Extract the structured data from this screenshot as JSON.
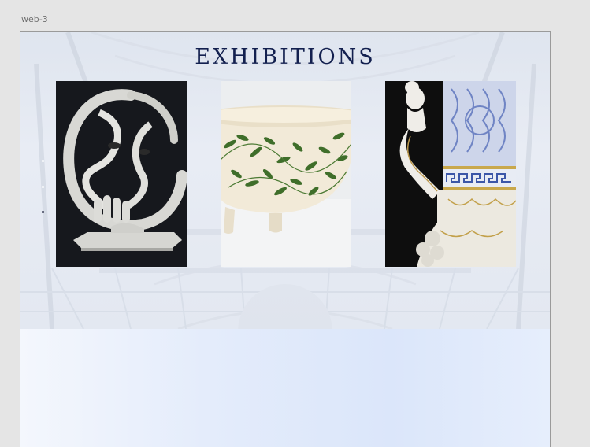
{
  "frame": {
    "label": "web-3"
  },
  "hero": {
    "title": "EXHIBITIONS"
  },
  "exhibits": [
    {
      "name": "ceramic-face-sculpture",
      "subject": "abstract white ceramic sculpture of faces in a ring on a dark background"
    },
    {
      "name": "leaf-pattern-bowl",
      "subject": "footed cream bowl painted with green leaf pattern"
    },
    {
      "name": "porcelain-vase-figure",
      "subject": "white and gold porcelain vase with blue pattern and figure handle"
    }
  ],
  "colors": {
    "title": "#13204f",
    "page_background": "#e5e5e5",
    "hero_tint": "#e3e8f1",
    "lower_tint": "#dbe6fa"
  }
}
